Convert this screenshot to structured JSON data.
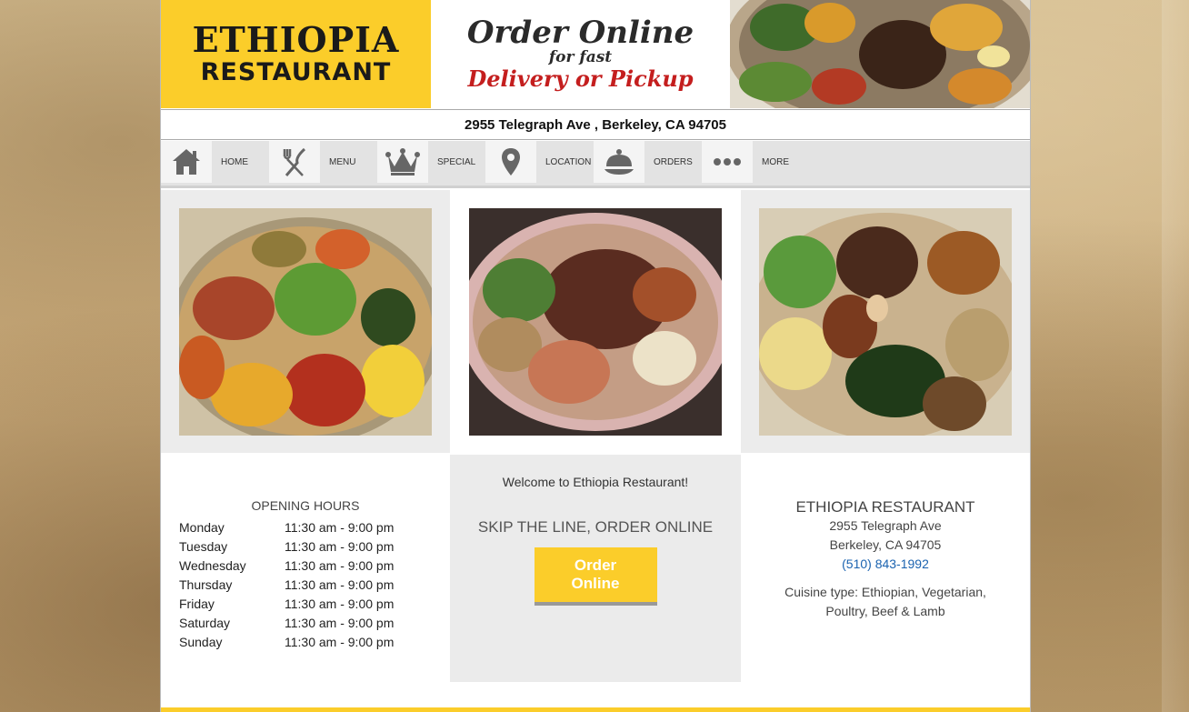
{
  "banner": {
    "logo_line1": "ETHIOPIA",
    "logo_line2": "RESTAURANT",
    "order_line1": "Order Online",
    "order_line2": "for fast",
    "order_line3": "Delivery or Pickup"
  },
  "address": "2955 Telegraph Ave , Berkeley, CA 94705",
  "nav": [
    {
      "label": "HOME",
      "icon": "home-icon"
    },
    {
      "label": "MENU",
      "icon": "fork-knife-icon"
    },
    {
      "label": "SPECIAL",
      "icon": "crown-icon"
    },
    {
      "label": "LOCATION",
      "icon": "map-pin-icon"
    },
    {
      "label": "ORDERS",
      "icon": "cloche-icon"
    },
    {
      "label": "MORE",
      "icon": "more-dots-icon"
    }
  ],
  "hours": {
    "title": "OPENING HOURS",
    "rows": [
      {
        "day": "Monday",
        "time": "11:30 am - 9:00 pm"
      },
      {
        "day": "Tuesday",
        "time": "11:30 am - 9:00 pm"
      },
      {
        "day": "Wednesday",
        "time": "11:30 am - 9:00 pm"
      },
      {
        "day": "Thursday",
        "time": "11:30 am - 9:00 pm"
      },
      {
        "day": "Friday",
        "time": "11:30 am - 9:00 pm"
      },
      {
        "day": "Saturday",
        "time": "11:30 am - 9:00 pm"
      },
      {
        "day": "Sunday",
        "time": "11:30 am - 9:00 pm"
      }
    ]
  },
  "middle": {
    "welcome": "Welcome to Ethiopia Restaurant!",
    "skip": "SKIP THE LINE, ORDER ONLINE",
    "order_button": "Order Online"
  },
  "contact": {
    "name": "ETHIOPIA RESTAURANT",
    "street": "2955 Telegraph Ave",
    "city": "Berkeley, CA 94705",
    "phone": "(510) 843-1992",
    "cuisine": "Cuisine type: Ethiopian, Vegetarian, Poultry, Beef & Lamb"
  },
  "colors": {
    "brand_yellow": "#fbcd2a",
    "phone_blue": "#1b63b0",
    "delivery_red": "#c41e1e"
  }
}
